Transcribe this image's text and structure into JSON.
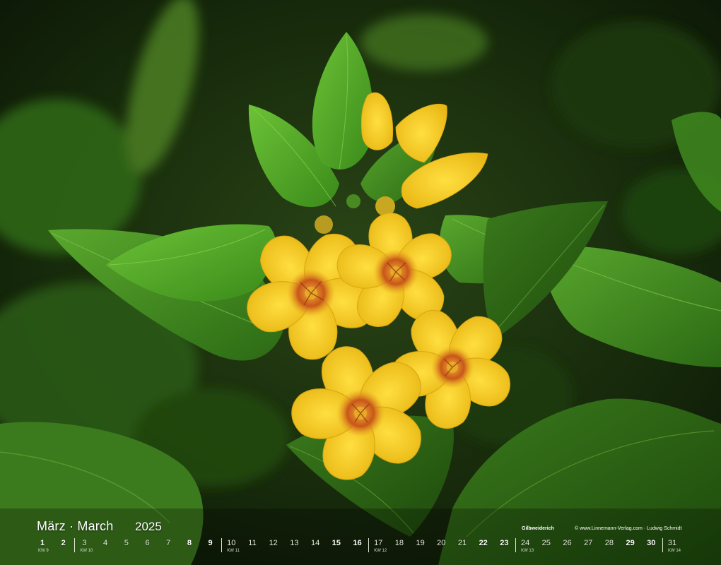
{
  "calendar": {
    "month_label": "März · March",
    "year": "2025",
    "plant_name": "Gilbweiderich",
    "credit": "© www.Linnemann-Verlag.com · Ludwig Schmidt",
    "days": [
      "1",
      "2",
      "3",
      "4",
      "5",
      "6",
      "7",
      "8",
      "9",
      "10",
      "11",
      "12",
      "13",
      "14",
      "15",
      "16",
      "17",
      "18",
      "19",
      "20",
      "21",
      "22",
      "23",
      "24",
      "25",
      "26",
      "27",
      "28",
      "29",
      "30",
      "31"
    ],
    "bold_days": [
      "1",
      "2",
      "8",
      "9",
      "15",
      "16",
      "22",
      "23",
      "29",
      "30"
    ],
    "week_labels": [
      "KW 9",
      "KW 10",
      "KW 11",
      "KW 12",
      "KW 13",
      "KW 14"
    ]
  },
  "colors": {
    "background_dark": "#0e1a08",
    "leaf_green": "#3f8a1f",
    "petal_yellow": "#f2c81e",
    "flower_center": "#c8561a",
    "text": "#ffffff"
  }
}
